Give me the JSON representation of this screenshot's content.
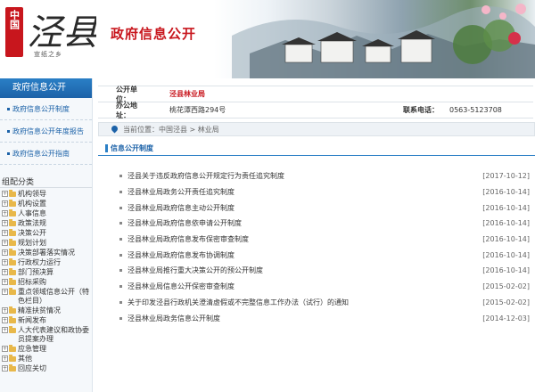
{
  "banner": {
    "seal_text": "中国",
    "calligraphy": "泾县",
    "slogan": "宣纸之乡",
    "title": "政府信息公开"
  },
  "sidebar": {
    "header": "政府信息公开",
    "links": [
      {
        "label": "政府信息公开制度"
      },
      {
        "label": "政府信息公开年度报告"
      },
      {
        "label": "政府信息公开指南"
      }
    ],
    "category_title": "组配分类",
    "categories": [
      {
        "toggle": "+",
        "label": "机构领导"
      },
      {
        "toggle": "+",
        "label": "机构设置"
      },
      {
        "toggle": "+",
        "label": "人事信息"
      },
      {
        "toggle": "+",
        "label": "政策法规"
      },
      {
        "toggle": "+",
        "label": "决策公开"
      },
      {
        "toggle": "+",
        "label": "规划计划"
      },
      {
        "toggle": "+",
        "label": "决策部署落实情况"
      },
      {
        "toggle": "+",
        "label": "行政权力运行"
      },
      {
        "toggle": "+",
        "label": "部门预决算"
      },
      {
        "toggle": "+",
        "label": "招标采购"
      },
      {
        "toggle": "+",
        "label": "重点领域信息公开（特色栏目）"
      },
      {
        "toggle": "+",
        "label": "精准扶贫情况"
      },
      {
        "toggle": "+",
        "label": "新闻发布"
      },
      {
        "toggle": "+",
        "label": "人大代表建议和政协委员提案办理"
      },
      {
        "toggle": "+",
        "label": "应急管理"
      },
      {
        "toggle": "+",
        "label": "其他"
      },
      {
        "toggle": "+",
        "label": "回应关切"
      }
    ]
  },
  "info": {
    "unit_label": "公开单位：",
    "unit_value": "泾县林业局",
    "address_label": "办公地址：",
    "address_value": "桃花潭西路294号",
    "phone_label": "联系电话：",
    "phone_value": "0563-5123708"
  },
  "crumb": {
    "prefix": "当前位置：",
    "home": "中国泾县",
    "sep": " > ",
    "current": "林业局"
  },
  "section": {
    "title": "信息公开制度"
  },
  "items": [
    {
      "title": "泾县关于违反政府信息公开规定行为责任追究制度",
      "date": "[2017-10-12]"
    },
    {
      "title": "泾县林业局政务公开责任追究制度",
      "date": "[2016-10-14]"
    },
    {
      "title": "泾县林业局政府信息主动公开制度",
      "date": "[2016-10-14]"
    },
    {
      "title": "泾县林业局政府信息依申请公开制度",
      "date": "[2016-10-14]"
    },
    {
      "title": "泾县林业局政府信息发布保密审查制度",
      "date": "[2016-10-14]"
    },
    {
      "title": "泾县林业局政府信息发布协调制度",
      "date": "[2016-10-14]"
    },
    {
      "title": "泾县林业局推行重大决策公开的预公开制度",
      "date": "[2016-10-14]"
    },
    {
      "title": "泾县林业局信息公开保密审查制度",
      "date": "[2015-02-02]"
    },
    {
      "title": "关于印发泾县行政机关澄清虚假或不完整信息工作办法（试行）的通知",
      "date": "[2015-02-02]"
    },
    {
      "title": "泾县林业局政务信息公开制度",
      "date": "[2014-12-03]"
    }
  ],
  "colors": {
    "primary_blue": "#1c62a8",
    "accent_red": "#c8161d"
  }
}
